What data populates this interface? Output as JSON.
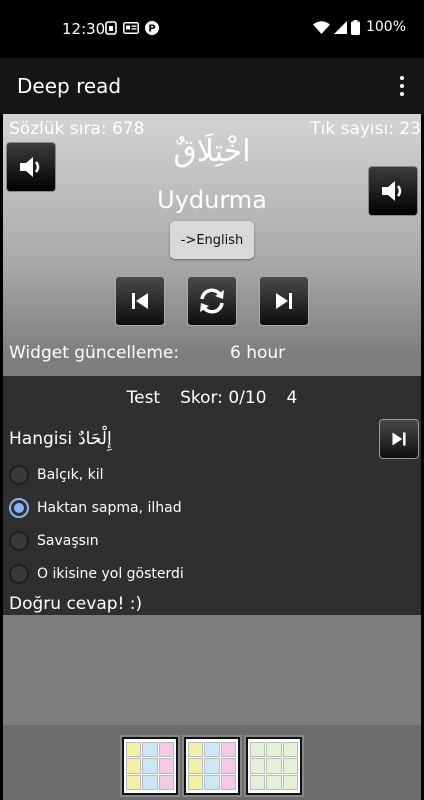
{
  "status_bar": {
    "time": "12:30",
    "battery_text": "100%",
    "left_icons": [
      "sim-icon",
      "news-icon",
      "parking-icon"
    ],
    "right_icons": [
      "wifi-icon",
      "signal-icon",
      "battery-icon"
    ]
  },
  "app_bar": {
    "title": "Deep read",
    "menu_icon": "overflow-menu-icon"
  },
  "word_card": {
    "dict_index_label": "Sözlük sıra: 678",
    "tap_count_label": "Tık sayısı: 23",
    "arabic_word": "اخْتِلَاقٌ",
    "translation": "Uydurma",
    "language_button": "->English"
  },
  "widget": {
    "label": "Widget güncelleme:",
    "value": "6 hour"
  },
  "quiz": {
    "title": "Test",
    "score": "Skor: 0/10",
    "count": "4",
    "question_prefix": "Hangisi",
    "question_word": "إِلْحَادٌ",
    "options": [
      {
        "label": "Balçık, kil",
        "checked": false
      },
      {
        "label": "Haktan sapma, ilhad",
        "checked": true
      },
      {
        "label": "Savaşsın",
        "checked": false
      },
      {
        "label": "O ikisine yol gösterdi",
        "checked": false
      }
    ],
    "result": "Doğru cevap! :)"
  },
  "colors": {
    "radio_accent": "#8ab4f8",
    "quiz_background": "#2f2f2f",
    "app_bar": "#161616"
  }
}
